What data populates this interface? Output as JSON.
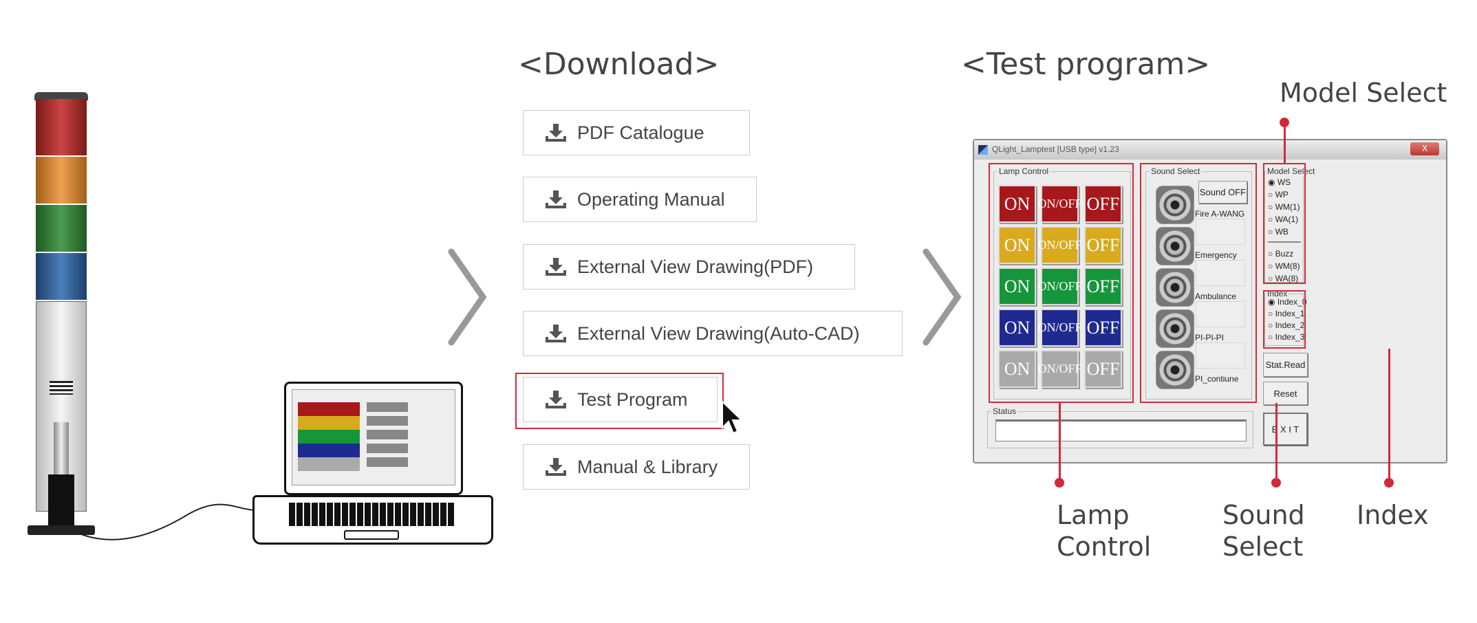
{
  "download": {
    "heading": "<Download>",
    "items": [
      {
        "label": "PDF Catalogue"
      },
      {
        "label": "Operating Manual"
      },
      {
        "label": "External View Drawing(PDF)"
      },
      {
        "label": "External View Drawing(Auto-CAD)"
      },
      {
        "label": "Test Program",
        "highlighted": true
      },
      {
        "label": "Manual & Library"
      }
    ]
  },
  "test_program": {
    "heading": "<Test program>",
    "window": {
      "title": "QLight_Lamptest [USB type]  v1.23",
      "close": "X",
      "lamp_control": {
        "label": "Lamp Control",
        "columns": [
          "ON",
          "ON/OFF",
          "OFF"
        ],
        "rows": [
          {
            "color": "#a8171c"
          },
          {
            "color": "#d9aa1e"
          },
          {
            "color": "#15963a"
          },
          {
            "color": "#1f2a91"
          },
          {
            "color": "#a9a9a9"
          }
        ]
      },
      "sound_select": {
        "label": "Sound Select",
        "sound_off": "Sound OFF",
        "sounds": [
          "Fire A-WANG",
          "Emergency",
          "Ambulance",
          "PI-PI-PI",
          "PI_contiune"
        ]
      },
      "model_select": {
        "label": "Model Select",
        "options": [
          "WS",
          "WP",
          "WM(1)",
          "WA(1)",
          "WB",
          "Buzz",
          "WM(8)",
          "WA(8)"
        ],
        "selected": "WS"
      },
      "index": {
        "label": "Index",
        "options": [
          "Index_0",
          "Index_1",
          "Index_2",
          "Index_3"
        ],
        "selected": "Index_0"
      },
      "stat_read": "Stat.Read",
      "reset": "Reset",
      "exit": "E X I T",
      "status_label": "Status",
      "status_value": ""
    }
  },
  "callouts": {
    "model_select": "Model Select",
    "lamp_control": [
      "Lamp",
      "Control"
    ],
    "sound_select": [
      "Sound",
      "Select"
    ],
    "index": "Index"
  },
  "colors": {
    "accent": "#d32a3a"
  }
}
